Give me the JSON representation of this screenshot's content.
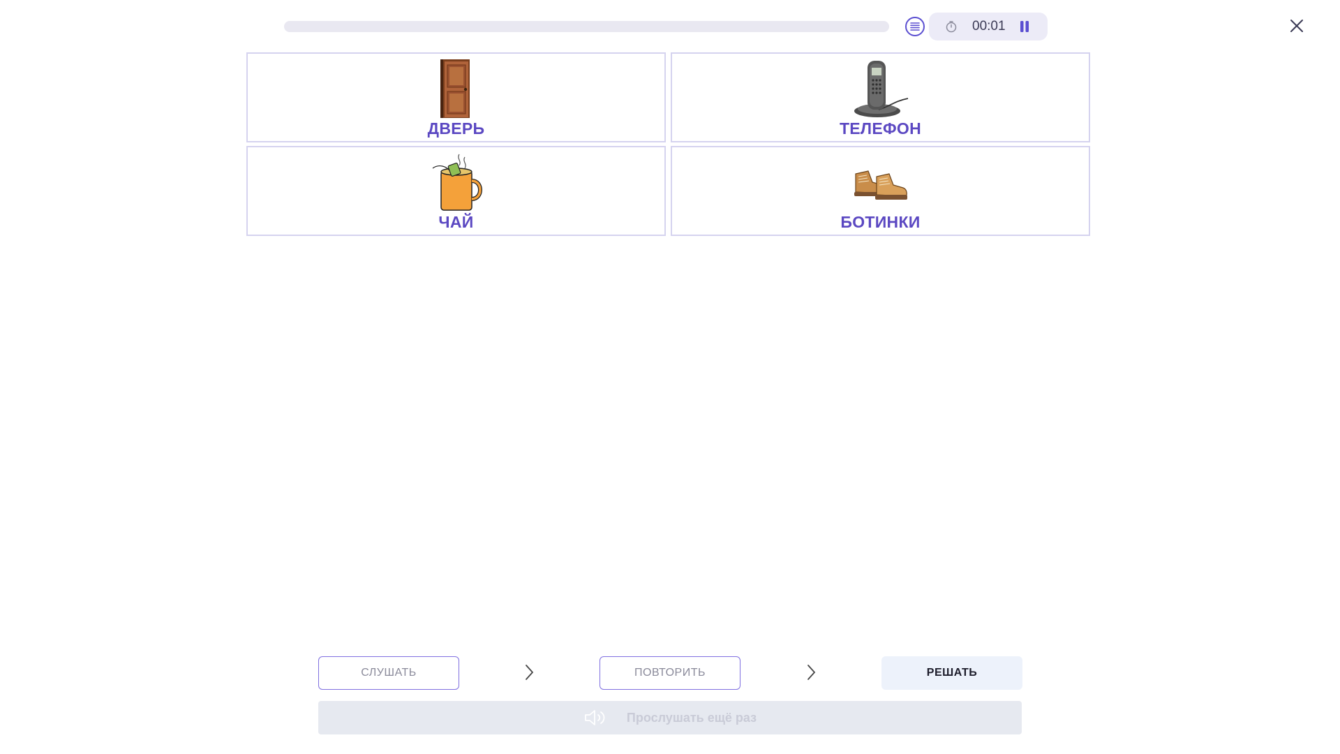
{
  "header": {
    "progress_fraction": 0.0,
    "list_icon": "list-icon",
    "timer": {
      "icon": "stopwatch-icon",
      "value": "00:01"
    },
    "pause_icon": "pause-icon",
    "close_icon": "close-icon"
  },
  "cards": [
    {
      "label": "ДВЕРЬ",
      "image": "door-image"
    },
    {
      "label": "ТЕЛЕФОН",
      "image": "cordless-phone-image"
    },
    {
      "label": "ЧАЙ",
      "image": "tea-mug-image"
    },
    {
      "label": "БОТИНКИ",
      "image": "boots-image"
    }
  ],
  "steps": {
    "listen_label": "СЛУШАТЬ",
    "repeat_label": "ПОВТОРИТЬ",
    "solve_label": "РЕШАТЬ"
  },
  "replay": {
    "label": "Прослушать ещё раз",
    "icon": "speaker-icon"
  },
  "colors": {
    "accent": "#5b48c2",
    "card_border": "#d5d3ef",
    "progress_track": "#e9e8f1",
    "timer_bg": "#ecebf7",
    "solve_bg": "#edf2fb",
    "replay_bg": "#e6e9f0"
  }
}
